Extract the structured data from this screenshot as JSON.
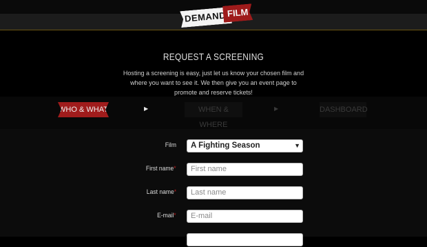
{
  "brand": {
    "logo_word1": "DEMAND",
    "logo_word2": "FILM"
  },
  "page": {
    "title": "REQUEST A SCREENING",
    "intro": "Hosting a screening is easy, just let us know your chosen film and where you want to see it. We then give you an event page to promote and reserve tickets!"
  },
  "steps": [
    {
      "label": "WHO & WHAT",
      "active": true
    },
    {
      "label": "WHEN & WHERE",
      "active": false
    },
    {
      "label": "DASHBOARD",
      "active": false
    }
  ],
  "step_arrow": "▶",
  "form": {
    "film_label": "Film",
    "film_value": "A Fighting Season",
    "first_name_label": "First name",
    "first_name_placeholder": "First name",
    "last_name_label": "Last name",
    "last_name_placeholder": "Last name",
    "email_label": "E-mail",
    "email_placeholder": "E-mail",
    "required_mark": "*"
  },
  "colors": {
    "accent": "#a01c1c",
    "background": "#000000"
  }
}
